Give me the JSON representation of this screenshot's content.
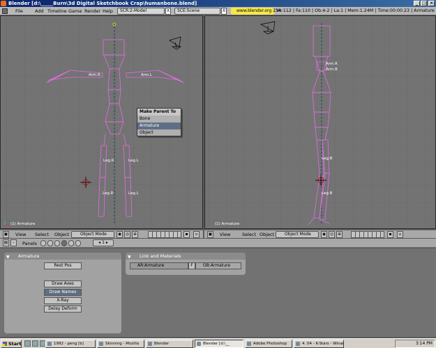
{
  "window": {
    "title": "Blender [d:\\_____Burn\\3d Digital Sketchbook Crap\\humanbone.blend]",
    "min": "_",
    "max": "□",
    "close": "×"
  },
  "menubar": {
    "items": [
      "File",
      "Add",
      "Timeline",
      "Game",
      "Render",
      "Help"
    ],
    "screen": "SCR:2-Model",
    "scene": "SCE:Scene",
    "url": "www.blender.org 234",
    "stats": "Ve:112 | Fa:110 | Ob:4-2 | La:1 | Mem:1.24M | Time:00:00.23 | Armature",
    "close": "X"
  },
  "left_view": {
    "label": "(1) Armature",
    "bones": {
      "arm_r": "Arm.R",
      "arm_l": "Arm.L",
      "leg_r": "Leg.R",
      "leg_l": "Leg.L",
      "leg_r2": "Leg.R",
      "leg_l2": "Leg.L"
    }
  },
  "right_view": {
    "label": "(1) Armature",
    "bones": {
      "arm_r": "Arm.R",
      "arm_b": "Arm.B",
      "leg_b": "Leg.B",
      "leg_b2": "Leg.B"
    }
  },
  "context_menu": {
    "title": "Make Parent To",
    "items": [
      "Bone",
      "Armature",
      "Object"
    ],
    "selected": "Armature"
  },
  "header_left": {
    "view": "View",
    "select": "Select",
    "object": "Object",
    "mode": "Object Mode"
  },
  "header_right": {
    "view": "View",
    "select": "Select",
    "object": "Object",
    "mode": "Object Mode"
  },
  "buttons_header": {
    "panels": "Panels",
    "page": "1"
  },
  "armature_panel": {
    "title": "Armature",
    "rest_pos": "Rest Pos",
    "draw_axes": "Draw Axes",
    "draw_names": "Draw Names",
    "xray": "X-Ray",
    "delay_deform": "Delay Deform"
  },
  "link_panel": {
    "title": "Link and Materials",
    "ar": "AR:Armature",
    "f": "F",
    "ob": "OB:Armature"
  },
  "taskbar": {
    "start": "Start",
    "tasks": [
      "1992 - peng [b]",
      "Skinning - Mozilla",
      "Blender",
      "Blender [d:\\__",
      "Adobe Photoshop",
      "4. 04 - K-Stars - Winamp"
    ],
    "active": 3,
    "clock": "3:14 PM"
  },
  "colors": {
    "bone": "#e36ee3",
    "grid": "#666666",
    "selected": "#5e6f85"
  }
}
